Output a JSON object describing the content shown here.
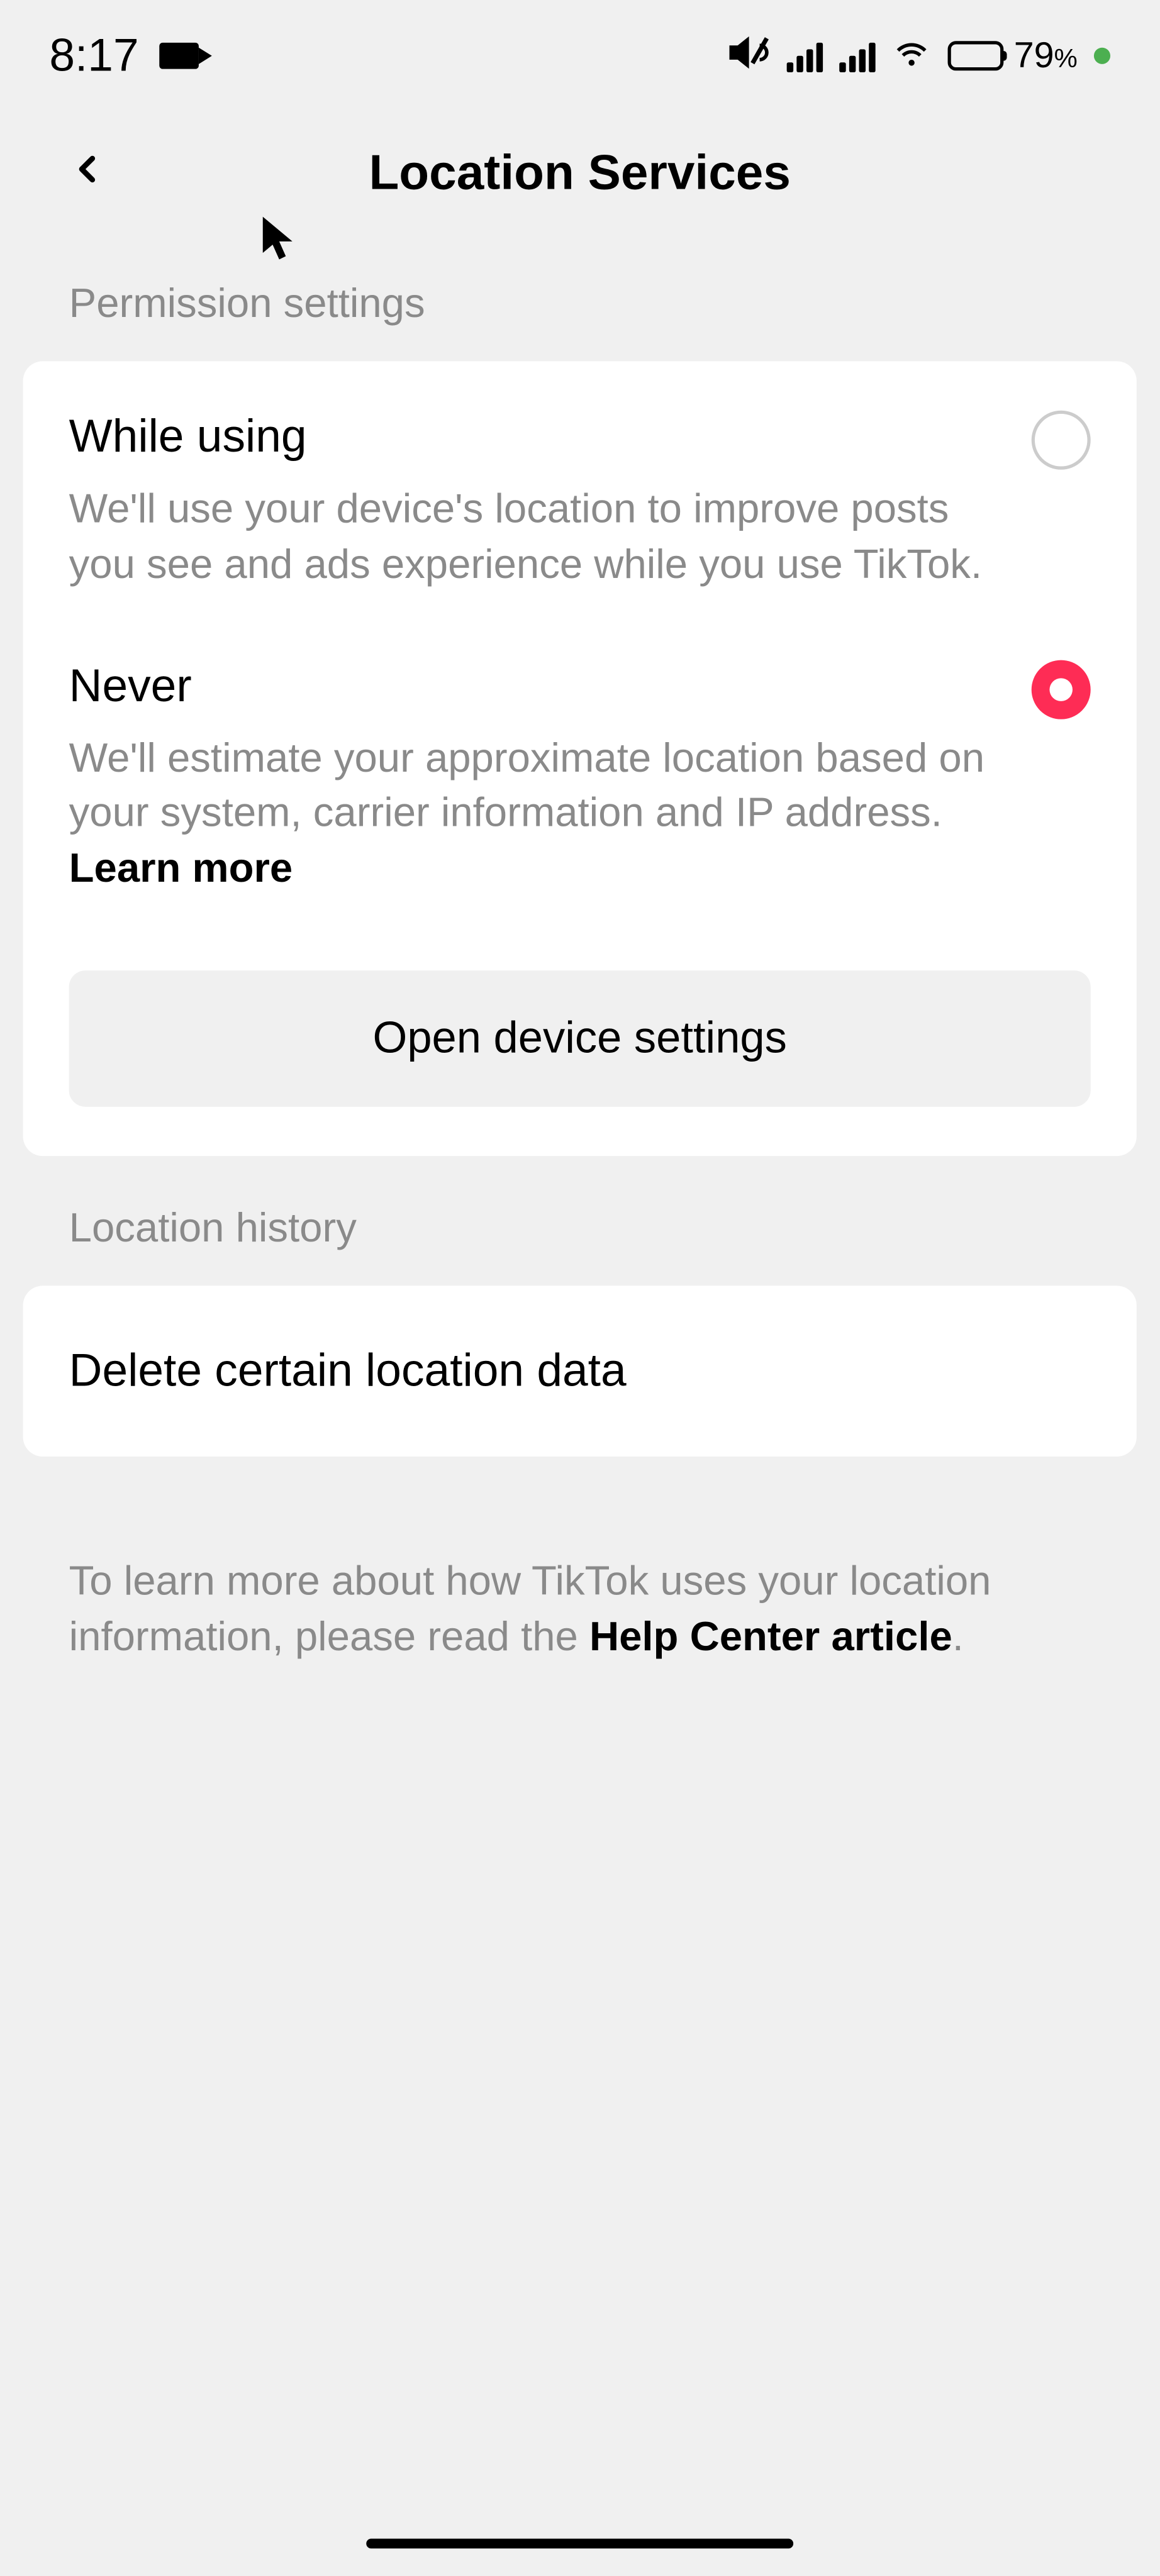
{
  "status": {
    "time": "8:17",
    "battery_percent": "79",
    "percent_symbol": "%"
  },
  "header": {
    "title": "Location Services"
  },
  "permission": {
    "section_label": "Permission settings",
    "while_using": {
      "title": "While using",
      "description": "We'll use your device's location to improve posts you see and ads experience while you use TikTok."
    },
    "never": {
      "title": "Never",
      "description": "We'll estimate your approximate location based on your system, carrier information and IP address. ",
      "learn_more": "Learn more"
    },
    "open_settings": "Open device settings"
  },
  "history": {
    "section_label": "Location history",
    "delete_label": "Delete certain location data"
  },
  "footer": {
    "text_part1": "To learn more about how TikTok uses your location information, please read the ",
    "link": "Help Center article",
    "text_part2": "."
  }
}
